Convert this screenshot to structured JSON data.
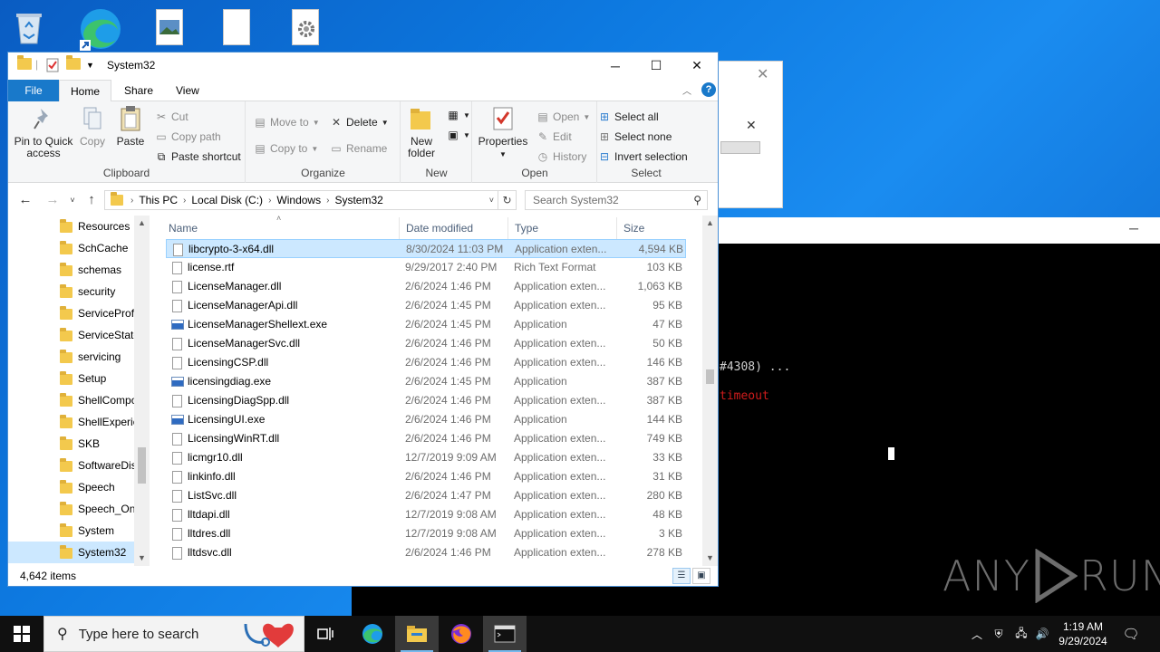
{
  "desktop": {
    "console": {
      "line1": "#4308) ...",
      "line2": "timeout"
    },
    "watermark": {
      "left": "ANY",
      "right": "RUN"
    }
  },
  "explorer": {
    "title": "System32",
    "window_buttons": {
      "minimize": "─",
      "maximize": "☐",
      "close": "✕"
    },
    "tabs": {
      "file": "File",
      "home": "Home",
      "share": "Share",
      "view": "View"
    },
    "ribbon": {
      "clipboard": {
        "label": "Clipboard",
        "pin": "Pin to Quick access",
        "copy": "Copy",
        "paste": "Paste",
        "cut": "Cut",
        "copy_path": "Copy path",
        "paste_shortcut": "Paste shortcut"
      },
      "organize": {
        "label": "Organize",
        "move_to": "Move to",
        "copy_to": "Copy to",
        "delete": "Delete",
        "rename": "Rename"
      },
      "new": {
        "label": "New",
        "new_folder": "New folder"
      },
      "open": {
        "label": "Open",
        "properties": "Properties",
        "open": "Open",
        "edit": "Edit",
        "history": "History"
      },
      "select": {
        "label": "Select",
        "select_all": "Select all",
        "select_none": "Select none",
        "invert": "Invert selection"
      }
    },
    "address": {
      "crumbs": [
        "This PC",
        "Local Disk (C:)",
        "Windows",
        "System32"
      ],
      "search_placeholder": "Search System32"
    },
    "nav": [
      "Resources",
      "SchCache",
      "schemas",
      "security",
      "ServiceProfi",
      "ServiceState",
      "servicing",
      "Setup",
      "ShellCompo",
      "ShellExperie",
      "SKB",
      "SoftwareDis",
      "Speech",
      "Speech_One",
      "System",
      "System32"
    ],
    "columns": {
      "name": "Name",
      "date": "Date modified",
      "type": "Type",
      "size": "Size"
    },
    "files": [
      {
        "name": "libcrypto-3-x64.dll",
        "date": "8/30/2024 11:03 PM",
        "type": "Application exten...",
        "size": "4,594 KB",
        "kind": "dll"
      },
      {
        "name": "license.rtf",
        "date": "9/29/2017 2:40 PM",
        "type": "Rich Text Format",
        "size": "103 KB",
        "kind": "doc"
      },
      {
        "name": "LicenseManager.dll",
        "date": "2/6/2024 1:46 PM",
        "type": "Application exten...",
        "size": "1,063 KB",
        "kind": "dll"
      },
      {
        "name": "LicenseManagerApi.dll",
        "date": "2/6/2024 1:45 PM",
        "type": "Application exten...",
        "size": "95 KB",
        "kind": "dll"
      },
      {
        "name": "LicenseManagerShellext.exe",
        "date": "2/6/2024 1:45 PM",
        "type": "Application",
        "size": "47 KB",
        "kind": "exe"
      },
      {
        "name": "LicenseManagerSvc.dll",
        "date": "2/6/2024 1:46 PM",
        "type": "Application exten...",
        "size": "50 KB",
        "kind": "dll"
      },
      {
        "name": "LicensingCSP.dll",
        "date": "2/6/2024 1:46 PM",
        "type": "Application exten...",
        "size": "146 KB",
        "kind": "dll"
      },
      {
        "name": "licensingdiag.exe",
        "date": "2/6/2024 1:45 PM",
        "type": "Application",
        "size": "387 KB",
        "kind": "exe"
      },
      {
        "name": "LicensingDiagSpp.dll",
        "date": "2/6/2024 1:46 PM",
        "type": "Application exten...",
        "size": "387 KB",
        "kind": "dll"
      },
      {
        "name": "LicensingUI.exe",
        "date": "2/6/2024 1:46 PM",
        "type": "Application",
        "size": "144 KB",
        "kind": "exe"
      },
      {
        "name": "LicensingWinRT.dll",
        "date": "2/6/2024 1:46 PM",
        "type": "Application exten...",
        "size": "749 KB",
        "kind": "dll"
      },
      {
        "name": "licmgr10.dll",
        "date": "12/7/2019 9:09 AM",
        "type": "Application exten...",
        "size": "33 KB",
        "kind": "dll"
      },
      {
        "name": "linkinfo.dll",
        "date": "2/6/2024 1:46 PM",
        "type": "Application exten...",
        "size": "31 KB",
        "kind": "dll"
      },
      {
        "name": "ListSvc.dll",
        "date": "2/6/2024 1:47 PM",
        "type": "Application exten...",
        "size": "280 KB",
        "kind": "dll"
      },
      {
        "name": "lltdapi.dll",
        "date": "12/7/2019 9:08 AM",
        "type": "Application exten...",
        "size": "48 KB",
        "kind": "dll"
      },
      {
        "name": "lltdres.dll",
        "date": "12/7/2019 9:08 AM",
        "type": "Application exten...",
        "size": "3 KB",
        "kind": "dll"
      },
      {
        "name": "lltdsvc.dll",
        "date": "2/6/2024 1:46 PM",
        "type": "Application exten...",
        "size": "278 KB",
        "kind": "dll"
      }
    ],
    "status": {
      "count": "4,642 items"
    }
  },
  "taskbar": {
    "search_placeholder": "Type here to search",
    "time": "1:19 AM",
    "date": "9/29/2024"
  }
}
